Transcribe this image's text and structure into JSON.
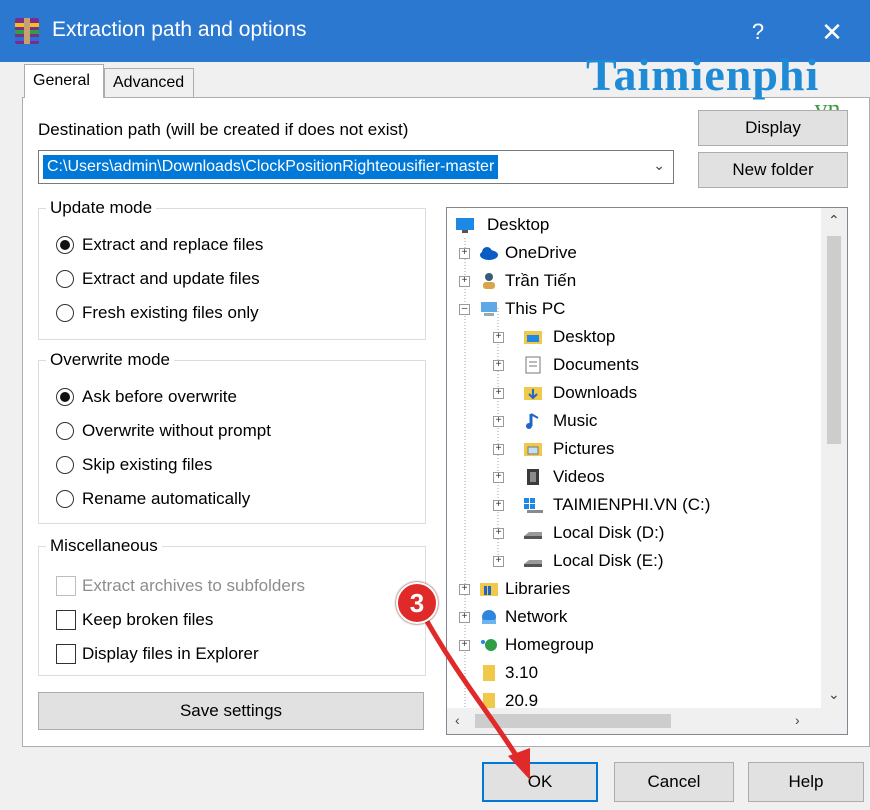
{
  "window": {
    "title": "Extraction path and options",
    "help_label": "?",
    "close_label": "✕"
  },
  "tabs": [
    "General",
    "Advanced"
  ],
  "watermark": {
    "text": "Taimienphi",
    "sub": ".vn"
  },
  "destination": {
    "label": "Destination path (will be created if does not exist)",
    "value": "C:\\Users\\admin\\Downloads\\ClockPositionRighteousifier-master"
  },
  "buttons": {
    "display": "Display",
    "new_folder": "New folder",
    "save_settings": "Save settings",
    "ok": "OK",
    "cancel": "Cancel",
    "help": "Help"
  },
  "update_mode": {
    "title": "Update mode",
    "options": [
      "Extract and replace files",
      "Extract and update files",
      "Fresh existing files only"
    ],
    "selected": 0
  },
  "overwrite_mode": {
    "title": "Overwrite mode",
    "options": [
      "Ask before overwrite",
      "Overwrite without prompt",
      "Skip existing files",
      "Rename automatically"
    ],
    "selected": 0
  },
  "miscellaneous": {
    "title": "Miscellaneous",
    "options": [
      {
        "label": "Extract archives to subfolders",
        "checked": false,
        "disabled": true
      },
      {
        "label": "Keep broken files",
        "checked": false,
        "disabled": false
      },
      {
        "label": "Display files in Explorer",
        "checked": false,
        "disabled": false
      }
    ]
  },
  "tree": {
    "items": [
      {
        "label": "Desktop",
        "icon": "desktop-icon"
      },
      {
        "label": "OneDrive",
        "icon": "onedrive-icon"
      },
      {
        "label": "Trần Tiến",
        "icon": "user-icon"
      },
      {
        "label": "This PC",
        "icon": "computer-icon"
      },
      {
        "label": "Desktop",
        "icon": "desktop-folder-icon"
      },
      {
        "label": "Documents",
        "icon": "documents-icon"
      },
      {
        "label": "Downloads",
        "icon": "downloads-icon"
      },
      {
        "label": "Music",
        "icon": "music-icon"
      },
      {
        "label": "Pictures",
        "icon": "pictures-icon"
      },
      {
        "label": "Videos",
        "icon": "videos-icon"
      },
      {
        "label": "TAIMIENPHI.VN (C:)",
        "icon": "windows-drive-icon"
      },
      {
        "label": "Local Disk (D:)",
        "icon": "disk-icon"
      },
      {
        "label": "Local Disk (E:)",
        "icon": "disk-icon"
      },
      {
        "label": "Libraries",
        "icon": "libraries-icon"
      },
      {
        "label": "Network",
        "icon": "network-icon"
      },
      {
        "label": "Homegroup",
        "icon": "homegroup-icon"
      },
      {
        "label": "3.10",
        "icon": "folder-icon"
      },
      {
        "label": "20.9",
        "icon": "folder-icon"
      }
    ]
  },
  "annotation": {
    "step": "3"
  },
  "colors": {
    "titlebar": "#2b78d0",
    "selection": "#0078d7",
    "annotation": "#e02a2a"
  }
}
